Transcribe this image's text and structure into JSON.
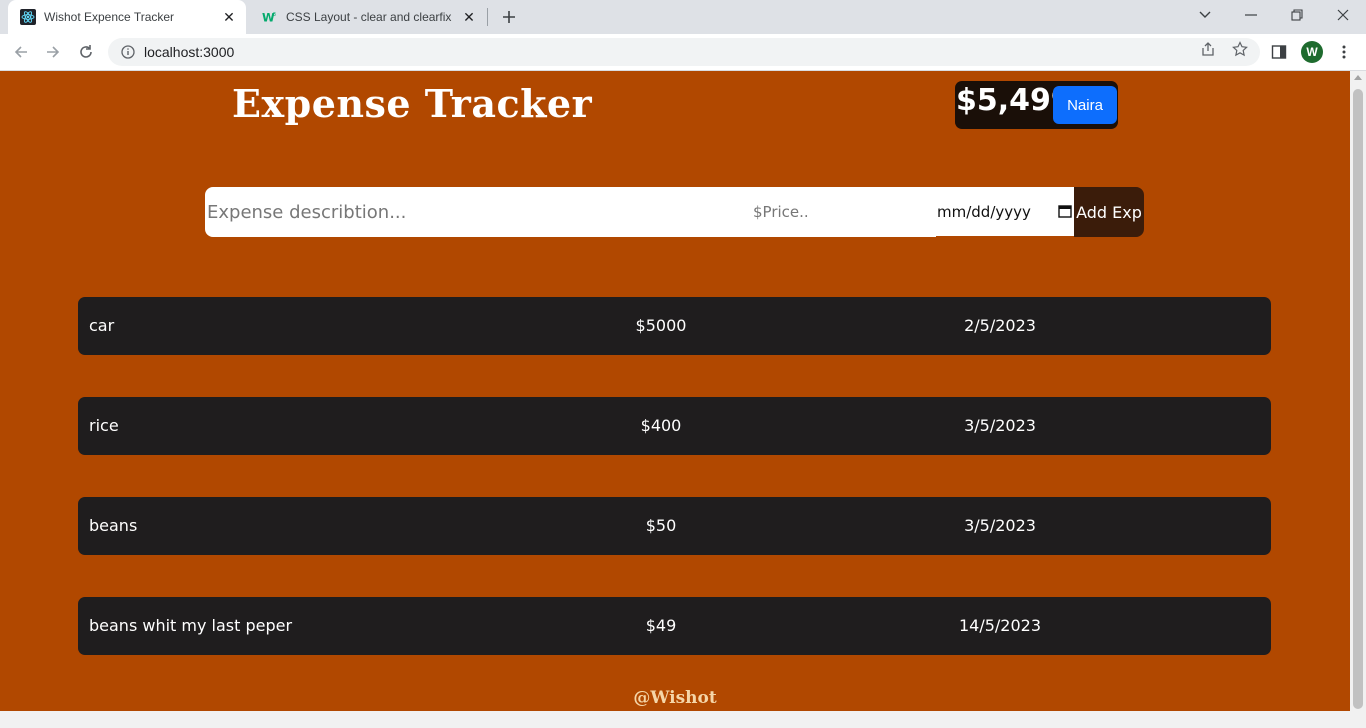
{
  "browser": {
    "tabs": [
      {
        "title": "Wishot Expence Tracker",
        "active": true
      },
      {
        "title": "CSS Layout - clear and clearfix",
        "active": false
      }
    ],
    "url": "localhost:3000",
    "profile_initial": "W"
  },
  "app": {
    "title": "Expense Tracker",
    "balance": "$5,499",
    "currency_button": "Naira",
    "form": {
      "description_placeholder": "Expense describtion...",
      "price_placeholder": "$Price..",
      "date_placeholder": "mm/dd/yyyy",
      "add_button": "Add Exp"
    },
    "expenses": [
      {
        "description": "car",
        "price": "$5000",
        "date": "2/5/2023"
      },
      {
        "description": "rice",
        "price": "$400",
        "date": "3/5/2023"
      },
      {
        "description": "beans",
        "price": "$50",
        "date": "3/5/2023"
      },
      {
        "description": "beans whit my last peper",
        "price": "$49",
        "date": "14/5/2023"
      }
    ],
    "footer": "@Wishot"
  },
  "colors": {
    "page_background": "#b14800",
    "row_background": "#1f1d1e",
    "currency_button": "#0d6efd",
    "add_button": "#3b1c0a"
  }
}
